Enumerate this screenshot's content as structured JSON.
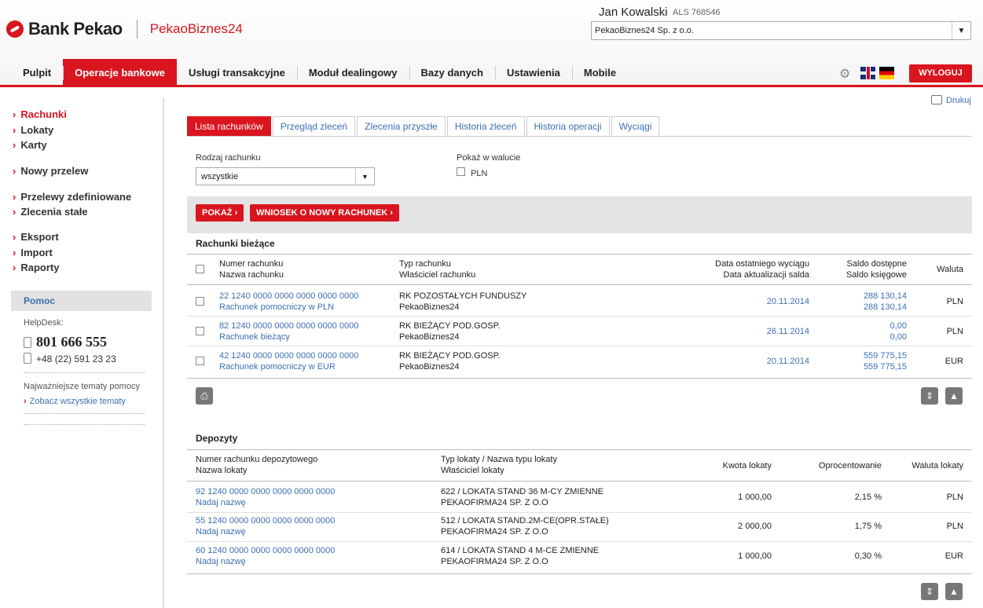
{
  "header": {
    "brand": "Bank Pekao",
    "product": "PekaoBiznes24",
    "user_name": "Jan Kowalski",
    "user_id": "ALS 768546",
    "company": "PekaoBiznes24 Sp. z o.o.",
    "logout": "WYLOGUJ"
  },
  "nav": [
    "Pulpit",
    "Operacje bankowe",
    "Usługi transakcyjne",
    "Moduł dealingowy",
    "Bazy danych",
    "Ustawienia",
    "Mobile"
  ],
  "sidebar": {
    "links": [
      "Rachunki",
      "Lokaty",
      "Karty",
      "Nowy przelew",
      "Przelewy zdefiniowane",
      "Zlecenia stałe",
      "Eksport",
      "Import",
      "Raporty"
    ],
    "help_title": "Pomoc",
    "helpdesk_label": "HelpDesk:",
    "phone_main": "801 666 555",
    "phone_alt": "+48 (22) 591 23 23",
    "topics_label": "Najważniejsze tematy pomocy",
    "topics_link": "Zobacz wszystkie tematy"
  },
  "print_link": "Drukuj",
  "tabs": [
    "Lista rachunków",
    "Przegląd zleceń",
    "Zlecenia przyszłe",
    "Historia zleceń",
    "Historia operacji",
    "Wyciągi"
  ],
  "filters": {
    "type_label": "Rodzaj rachunku",
    "type_value": "wszystkie",
    "currency_label": "Pokaż w walucie",
    "currency_option": "PLN"
  },
  "buttons": {
    "show": "POKAŻ",
    "new_account": "WNIOSEK O NOWY RACHUNEK"
  },
  "current": {
    "title": "Rachunki bieżące",
    "headers": {
      "num": "Numer rachunku",
      "name": "Nazwa rachunku",
      "type": "Typ rachunku",
      "owner": "Właściciel rachunku",
      "date1": "Data ostatniego wyciągu",
      "date2": "Data aktualizacji salda",
      "bal1": "Saldo dostępne",
      "bal2": "Saldo księgowe",
      "cur": "Waluta"
    },
    "rows": [
      {
        "num": "22 1240 0000 0000 0000 0000 0000",
        "name": "Rachunek pomocniczy w PLN",
        "type": "RK POZOSTAŁYCH FUNDUSZY",
        "owner": "PekaoBiznes24",
        "date": "20.11.2014",
        "avail": "288 130,14",
        "book": "288 130,14",
        "cur": "PLN"
      },
      {
        "num": "82 1240 0000 0000 0000 0000 0000",
        "name": "Rachunek bieżący",
        "type": "RK BIEŻĄCY POD.GOSP.",
        "owner": "PekaoBiznes24",
        "date": "26.11.2014",
        "avail": "0,00",
        "book": "0,00",
        "cur": "PLN"
      },
      {
        "num": "42 1240 0000 0000 0000 0000 0000",
        "name": "Rachunek pomocniczy w EUR",
        "type": "RK BIEŻĄCY POD.GOSP.",
        "owner": "PekaoBiznes24",
        "date": "20.11.2014",
        "avail": "559 775,15",
        "book": "559 775,15",
        "cur": "EUR"
      }
    ]
  },
  "deposits": {
    "title": "Depozyty",
    "headers": {
      "num": "Numer rachunku depozytowego",
      "name": "Nazwa lokaty",
      "type": "Typ lokaty / Nazwa typu lokaty",
      "owner": "Właściciel lokaty",
      "amount": "Kwota lokaty",
      "rate": "Oprocentowanie",
      "cur": "Waluta lokaty"
    },
    "rows": [
      {
        "num": "92 1240 0000 0000 0000 0000 0000",
        "name": "Nadaj nazwę",
        "type": "622 / LOKATA STAND 36 M-CY ZMIENNE",
        "owner": "PEKAOFIRMA24 SP. Z O.O",
        "amount": "1 000,00",
        "rate": "2,15 %",
        "cur": "PLN"
      },
      {
        "num": "55 1240 0000 0000 0000 0000 0000",
        "name": "Nadaj nazwę",
        "type": "512 / LOKATA STAND.2M-CE(OPR.STAŁE)",
        "owner": "PEKAOFIRMA24 SP. Z O.O",
        "amount": "2 000,00",
        "rate": "1,75 %",
        "cur": "PLN"
      },
      {
        "num": "60 1240 0000 0000 0000 0000 0000",
        "name": "Nadaj nazwę",
        "type": "614 / LOKATA STAND 4 M-CE ZMIENNE",
        "owner": "PEKAOFIRMA24 SP. Z O.O",
        "amount": "1 000,00",
        "rate": "0,30 %",
        "cur": "EUR"
      }
    ]
  }
}
